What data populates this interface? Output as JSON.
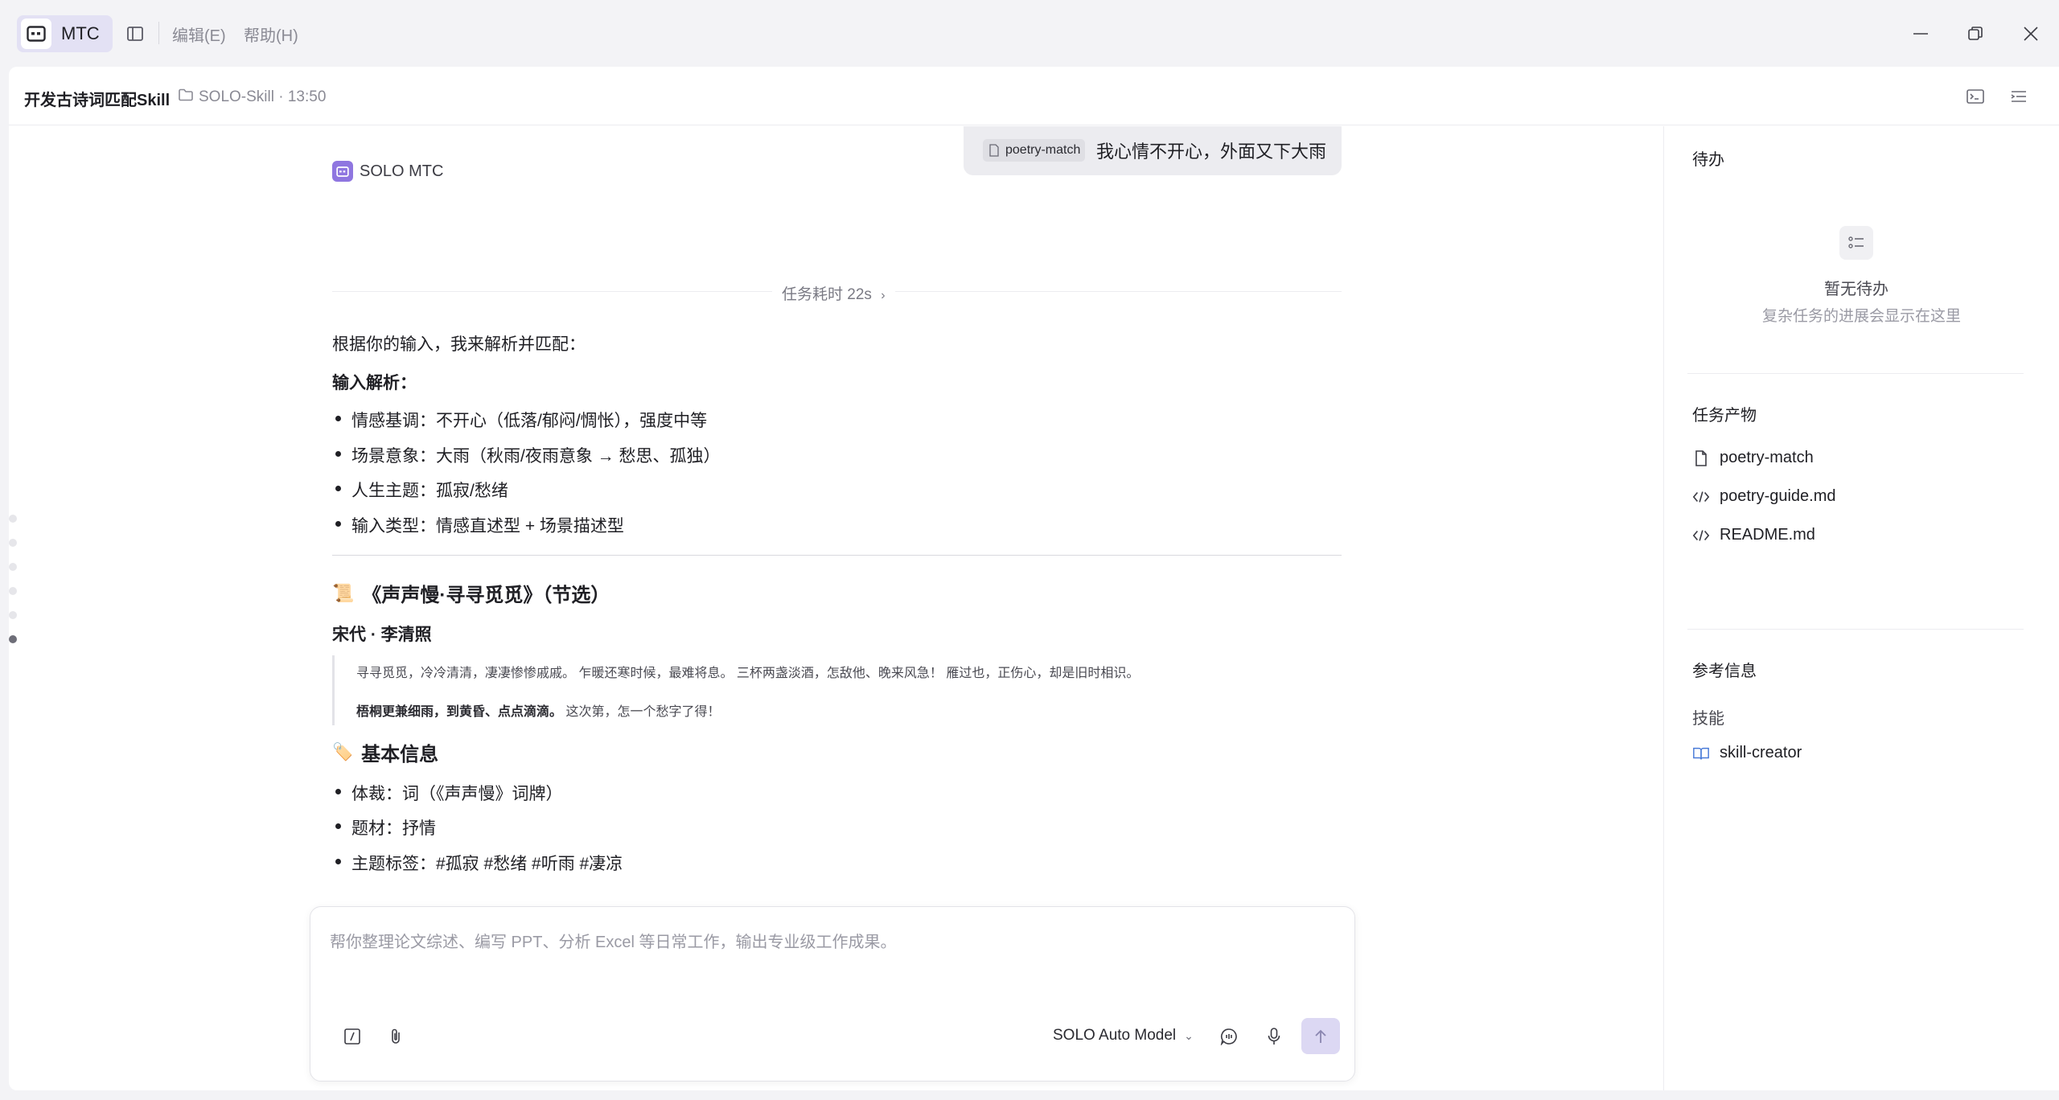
{
  "titlebar": {
    "app_name": "MTC",
    "menu": [
      "编辑(E)",
      "帮助(H)"
    ]
  },
  "header": {
    "project_title": "开发古诗词匹配Skill",
    "project_meta": "SOLO-Skill · 13:50"
  },
  "chat": {
    "user_message": {
      "chip": "poetry-match",
      "text": "我心情不开心，外面又下大雨"
    },
    "agent_name": "SOLO MTC",
    "task_time": "任务耗时 22s",
    "intro": "根据你的输入，我来解析并匹配：",
    "analysis_heading": "输入解析：",
    "analysis_items": [
      "情感基调：不开心（低落/郁闷/惆怅），强度中等",
      "场景意象：大雨（秋雨/夜雨意象 → 愁思、孤独）",
      "人生主题：孤寂/愁绪",
      "输入类型：情感直述型 + 场景描述型"
    ],
    "poem_emoji": "📜",
    "poem_title": "《声声慢·寻寻觅觅》（节选）",
    "poem_author": "宋代 · 李清照",
    "quote_line1": "寻寻觅觅，冷冷清清，凄凄惨惨戚戚。 乍暖还寒时候，最难将息。 三杯两盏淡酒，怎敌他、晚来风急！ 雁过也，正伤心，却是旧时相识。",
    "quote_line2_bold": "梧桐更兼细雨，到黄昏、点点滴滴。",
    "quote_line2_rest": " 这次第，怎一个愁字了得！",
    "info_emoji": "🏷️",
    "info_heading": "基本信息",
    "info_items": [
      "体裁：词（《声声慢》词牌）",
      "题材：抒情",
      "主题标签：#孤寂 #愁绪 #听雨 #凄凉"
    ]
  },
  "input": {
    "placeholder": "帮你整理论文综述、编写 PPT、分析 Excel 等日常工作，输出专业级工作成果。",
    "model": "SOLO Auto Model"
  },
  "sidebar": {
    "todo_title": "待办",
    "todo_empty_title": "暂无待办",
    "todo_empty_sub": "复杂任务的进展会显示在这里",
    "artifacts_title": "任务产物",
    "artifacts": [
      {
        "name": "poetry-match",
        "icon": "file-icon"
      },
      {
        "name": "poetry-guide.md",
        "icon": "code-icon"
      },
      {
        "name": "README.md",
        "icon": "code-icon"
      }
    ],
    "ref_title": "参考信息",
    "skills_label": "技能",
    "skill": "skill-creator"
  },
  "colors": {
    "accent": "#8f76e0",
    "app_pill": "#e3e1f4",
    "send_button": "#dcd8f3"
  }
}
